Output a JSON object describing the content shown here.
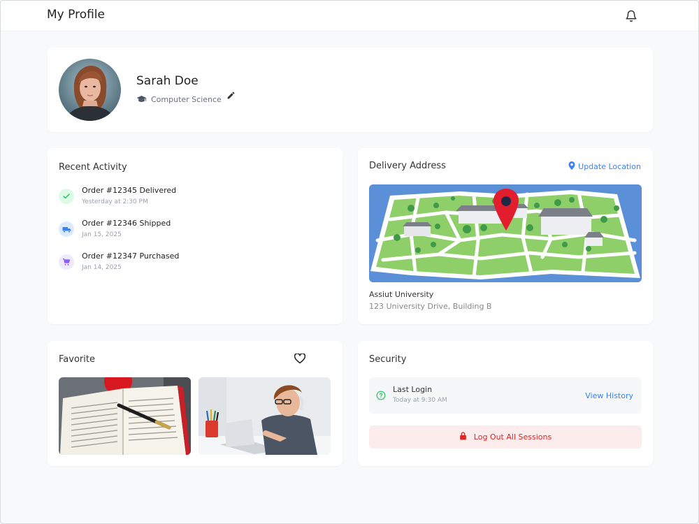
{
  "header": {
    "title": "My Profile",
    "notification_icon": "bell-icon"
  },
  "profile": {
    "name": "Sarah Doe",
    "department": "Computer Science",
    "department_icon": "graduation-cap-icon",
    "edit_icon": "pencil-icon"
  },
  "activity": {
    "title": "Recent Activity",
    "items": [
      {
        "title": "Order #12345 Delivered",
        "time": "Yesterday at 2:30 PM",
        "icon": "check-icon",
        "color": "#22c55e",
        "bg": "#dcfce7"
      },
      {
        "title": "Order #12346 Shipped",
        "time": "Jan 15, 2025",
        "icon": "truck-icon",
        "color": "#3b82f6",
        "bg": "#dbeafe"
      },
      {
        "title": "Order #12347 Purchased",
        "time": "Jan 14, 2025",
        "icon": "cart-icon",
        "color": "#8b5cf6",
        "bg": "#ede9fe"
      }
    ]
  },
  "delivery": {
    "title": "Delivery Address",
    "update_label": "Update Location",
    "location_name": "Assiut University",
    "address": "123 University Drive, Building B"
  },
  "favorite": {
    "title": "Favorite",
    "icon": "heart-icon"
  },
  "security": {
    "title": "Security",
    "last_login_label": "Last Login",
    "last_login_time": "Today at 9:30 AM",
    "view_history_label": "View History",
    "logout_label": "Log Out All Sessions"
  },
  "colors": {
    "accent": "#3b82f6",
    "danger": "#dc2626",
    "danger_bg": "#fdecec",
    "success": "#22c55e"
  }
}
